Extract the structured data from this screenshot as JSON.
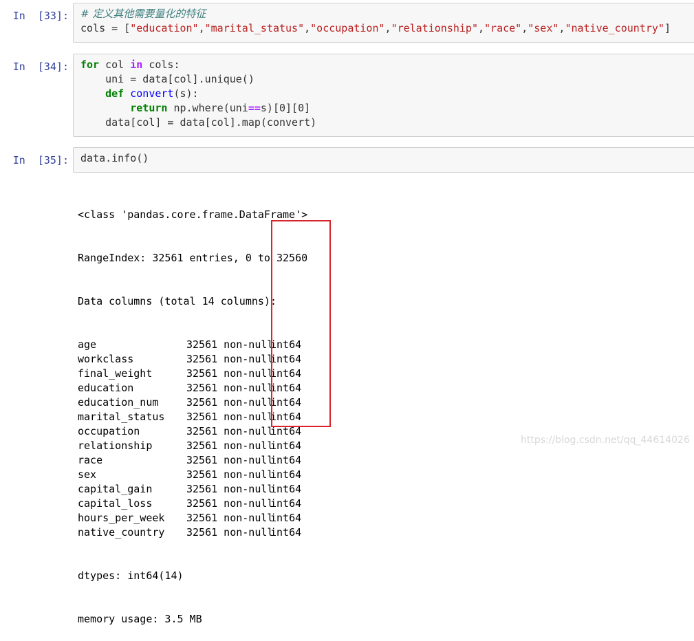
{
  "cells": [
    {
      "prompt": "In  [33]:",
      "lines": [
        [
          {
            "t": "cm",
            "v": "# 定义其他需要量化的特征"
          }
        ],
        [
          {
            "t": "plain",
            "v": "cols = ["
          },
          {
            "t": "str",
            "v": "\"education\""
          },
          {
            "t": "plain",
            "v": ","
          },
          {
            "t": "str",
            "v": "\"marital_status\""
          },
          {
            "t": "plain",
            "v": ","
          },
          {
            "t": "str",
            "v": "\"occupation\""
          },
          {
            "t": "plain",
            "v": ","
          },
          {
            "t": "str",
            "v": "\"relationship\""
          },
          {
            "t": "plain",
            "v": ","
          },
          {
            "t": "str",
            "v": "\"race\""
          },
          {
            "t": "plain",
            "v": ","
          },
          {
            "t": "str",
            "v": "\"sex\""
          },
          {
            "t": "plain",
            "v": ","
          },
          {
            "t": "str",
            "v": "\"native_country\""
          },
          {
            "t": "plain",
            "v": "]"
          }
        ]
      ]
    },
    {
      "prompt": "In  [34]:",
      "lines": [
        [
          {
            "t": "kw",
            "v": "for"
          },
          {
            "t": "plain",
            "v": " col "
          },
          {
            "t": "op",
            "v": "in"
          },
          {
            "t": "plain",
            "v": " cols:"
          }
        ],
        [
          {
            "t": "plain",
            "v": "    uni = data[col].unique()"
          }
        ],
        [
          {
            "t": "plain",
            "v": "    "
          },
          {
            "t": "kw",
            "v": "def"
          },
          {
            "t": "plain",
            "v": " "
          },
          {
            "t": "fn",
            "v": "convert"
          },
          {
            "t": "plain",
            "v": "(s):"
          }
        ],
        [
          {
            "t": "plain",
            "v": "        "
          },
          {
            "t": "kw",
            "v": "return"
          },
          {
            "t": "plain",
            "v": " np.where(uni"
          },
          {
            "t": "op",
            "v": "=="
          },
          {
            "t": "plain",
            "v": "s)[0][0]"
          }
        ],
        [
          {
            "t": "plain",
            "v": "    data[col] = data[col].map(convert)"
          }
        ]
      ]
    },
    {
      "prompt": "In  [35]:",
      "lines": [
        [
          {
            "t": "plain",
            "v": "data.info()"
          }
        ]
      ]
    }
  ],
  "output": {
    "header": [
      "<class 'pandas.core.frame.DataFrame'>",
      "RangeIndex: 32561 entries, 0 to 32560",
      "Data columns (total 14 columns):"
    ],
    "columns": [
      {
        "name": "age",
        "count": "32561 non-null",
        "dtype": "int64"
      },
      {
        "name": "workclass",
        "count": "32561 non-null",
        "dtype": "int64"
      },
      {
        "name": "final_weight",
        "count": "32561 non-null",
        "dtype": "int64"
      },
      {
        "name": "education",
        "count": "32561 non-null",
        "dtype": "int64"
      },
      {
        "name": "education_num",
        "count": "32561 non-null",
        "dtype": "int64"
      },
      {
        "name": "marital_status",
        "count": "32561 non-null",
        "dtype": "int64"
      },
      {
        "name": "occupation",
        "count": "32561 non-null",
        "dtype": "int64"
      },
      {
        "name": "relationship",
        "count": "32561 non-null",
        "dtype": "int64"
      },
      {
        "name": "race",
        "count": "32561 non-null",
        "dtype": "int64"
      },
      {
        "name": "sex",
        "count": "32561 non-null",
        "dtype": "int64"
      },
      {
        "name": "capital_gain",
        "count": "32561 non-null",
        "dtype": "int64"
      },
      {
        "name": "capital_loss",
        "count": "32561 non-null",
        "dtype": "int64"
      },
      {
        "name": "hours_per_week",
        "count": "32561 non-null",
        "dtype": "int64"
      },
      {
        "name": "native_country",
        "count": "32561 non-null",
        "dtype": "int64"
      }
    ],
    "footer": [
      "dtypes: int64(14)",
      "memory usage: 3.5 MB"
    ]
  },
  "watermark": "https://blog.csdn.net/qq_44614026",
  "colors": {
    "prompt": "#303f9f",
    "cell_bg": "#f7f7f7",
    "cell_border": "#cfcfcf",
    "keyword": "#008000",
    "string": "#ba2121",
    "comment": "#408080",
    "function": "#0000ff",
    "operator": "#aa22ff",
    "highlight_box": "#d9232d"
  }
}
